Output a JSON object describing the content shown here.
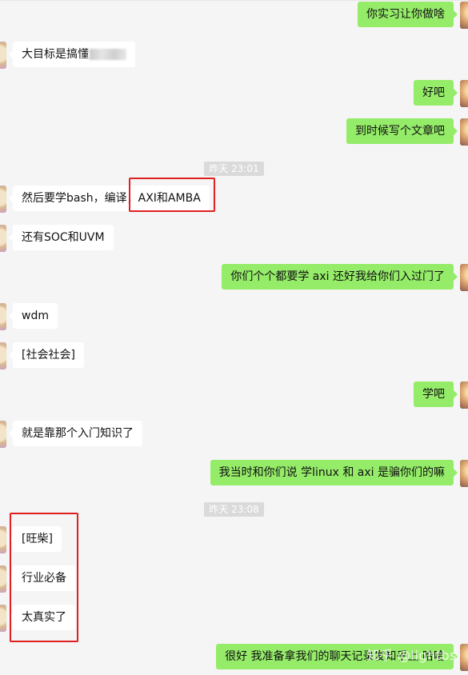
{
  "timestamps": [
    "昨天 23:01",
    "昨天 23:08"
  ],
  "messages": [
    {
      "side": "out",
      "text": "你实习让你做啥"
    },
    {
      "side": "in",
      "text": "大目标是搞懂"
    },
    {
      "side": "out",
      "text": "好吧"
    },
    {
      "side": "out",
      "text": "到时候写个文章吧"
    },
    {
      "side": "in",
      "text": "然后要学bash，编译，AXI和AMBA"
    },
    {
      "side": "in",
      "text": "还有SOC和UVM"
    },
    {
      "side": "out",
      "text": "你们个个都要学 axi 还好我给你们入过门了"
    },
    {
      "side": "in",
      "text": "wdm"
    },
    {
      "side": "in",
      "text": "[社会社会]"
    },
    {
      "side": "out",
      "text": "学吧"
    },
    {
      "side": "in",
      "text": "就是靠那个入门知识了"
    },
    {
      "side": "out",
      "text": "我当时和你们说 学linux 和 axi 是骗你们的嘛"
    },
    {
      "side": "in",
      "text": "[旺柴]"
    },
    {
      "side": "in",
      "text": "行业必备"
    },
    {
      "side": "in",
      "text": "太真实了"
    },
    {
      "side": "out",
      "text": "很好 我准备拿我们的聊天记录发知乎上 哈哈"
    }
  ],
  "watermark": "知乎 @lightbs",
  "colors": {
    "background": "#f5f5f5",
    "incoming_bubble": "#ffffff",
    "outgoing_bubble": "#95ec69",
    "highlight": "#e02020"
  }
}
